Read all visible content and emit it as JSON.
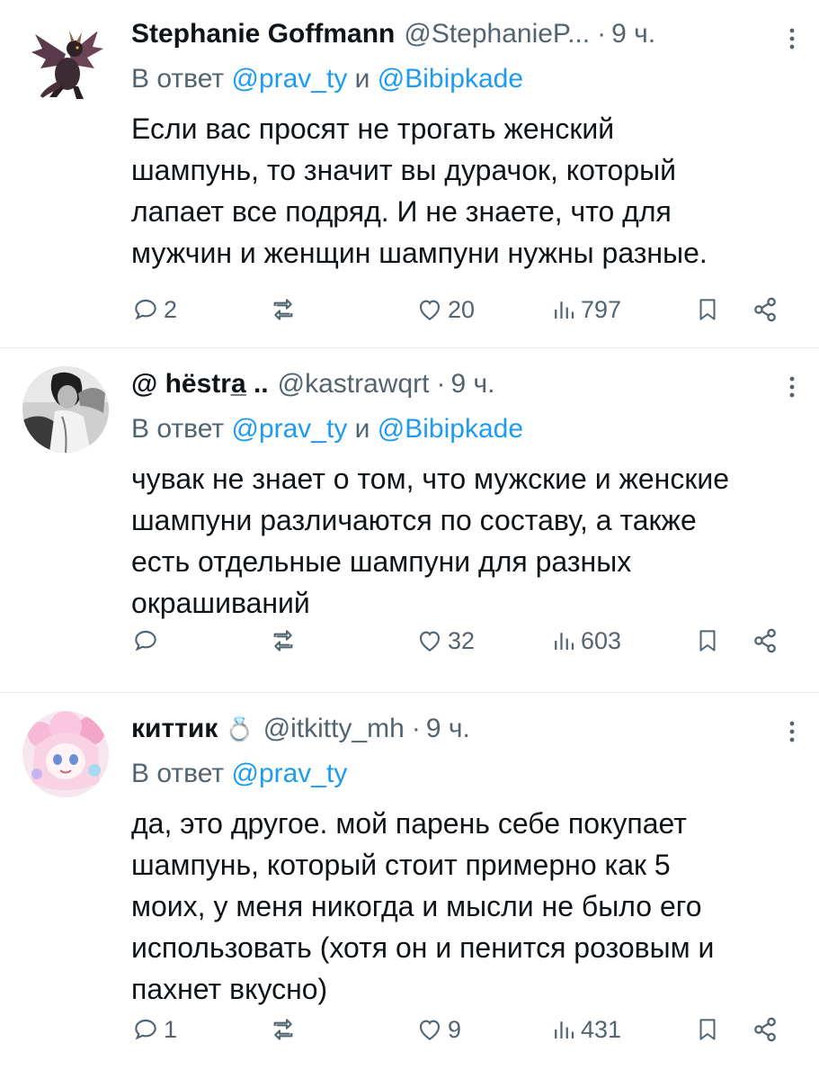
{
  "tweets": [
    {
      "display_name": "Stephanie Goffmann",
      "handle": "@StephanieP...",
      "separator": "·",
      "time": "9 ч.",
      "reply_prefix": "В ответ",
      "mention1": "@prav_ty",
      "conj": "и",
      "mention2": "@Bibipkade",
      "lines": [
        "Если вас просят не трогать женский",
        "шампунь, то значит вы дурачок, который",
        "лапает все подряд. И не знаете, что для",
        "мужчин и женщин шампуни нужны разные."
      ],
      "replies": "2",
      "retweets": "",
      "likes": "20",
      "views": "797",
      "avatar_icon": "dragon-avatar-icon"
    },
    {
      "display_name": "@ hëstra̲ ..",
      "handle": "@kastrawqrt",
      "separator": "·",
      "time": "9 ч.",
      "reply_prefix": "В ответ",
      "mention1": "@prav_ty",
      "conj": "и",
      "mention2": "@Bibipkade",
      "lines": [
        "чувак не знает о том, что мужские и женские",
        "шампуни различаются по составу, а также",
        "есть отдельные шампуни для разных",
        "окрашиваний"
      ],
      "replies": "",
      "retweets": "",
      "likes": "32",
      "views": "603",
      "avatar_icon": "grayscale-portrait-avatar"
    },
    {
      "display_name": "киттик",
      "badge": "💍",
      "handle": "@itkitty_mh",
      "separator": "·",
      "time": "9 ч.",
      "reply_prefix": "В ответ",
      "mention1": "@prav_ty",
      "lines": [
        "да, это другое. мой парень себе покупает",
        "шампунь, который стоит примерно как 5",
        "моих, у меня никогда и мысли не было его",
        "использовать (хотя он и пенится розовым и",
        "пахнет вкусно)"
      ],
      "replies": "1",
      "retweets": "",
      "likes": "9",
      "views": "431",
      "avatar_icon": "pink-anime-avatar"
    }
  ],
  "colors": {
    "text": "#0f1419",
    "secondary": "#536471",
    "link": "#1d9bf0",
    "divider": "#e7e9eb"
  }
}
